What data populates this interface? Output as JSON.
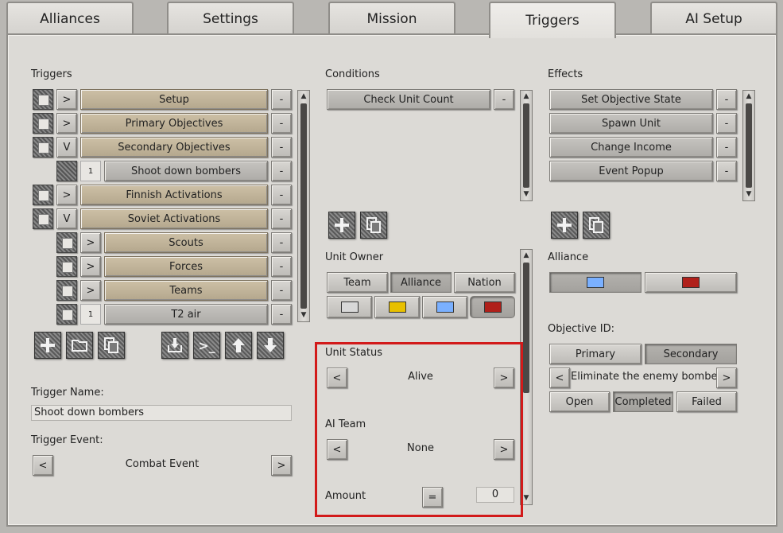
{
  "tabs": [
    "Alliances",
    "Settings",
    "Mission",
    "Triggers",
    "AI Setup"
  ],
  "triggers": {
    "heading": "Triggers",
    "items": [
      {
        "expander": ">",
        "label": "Setup"
      },
      {
        "expander": ">",
        "label": "Primary Objectives"
      },
      {
        "expander": "V",
        "label": "Secondary Objectives"
      },
      {
        "expander": "1",
        "label": "Shoot down bombers"
      },
      {
        "expander": ">",
        "label": "Finnish Activations"
      },
      {
        "expander": "V",
        "label": "Soviet Activations"
      },
      {
        "expander": ">",
        "label": "Scouts"
      },
      {
        "expander": ">",
        "label": "Forces"
      },
      {
        "expander": ">",
        "label": "Teams"
      },
      {
        "expander": "1",
        "label": "T2 air"
      }
    ],
    "remove_label": "-",
    "name_label": "Trigger Name:",
    "name_value": "Shoot down bombers",
    "event_label": "Trigger Event:",
    "event_value": "Combat Event",
    "prev": "<",
    "next": ">"
  },
  "conditions": {
    "heading": "Conditions",
    "items": [
      "Check Unit Count"
    ],
    "remove_label": "-"
  },
  "unit_owner": {
    "heading": "Unit Owner",
    "modes": [
      "Team",
      "Alliance",
      "Nation"
    ],
    "selected_mode": "Alliance",
    "colors": [
      "#d8d8d8",
      "#e8c000",
      "#7ab0ff",
      "#b0201a"
    ]
  },
  "unit_status": {
    "heading": "Unit Status",
    "value": "Alive",
    "prev": "<",
    "next": ">"
  },
  "ai_team": {
    "heading": "AI Team",
    "value": "None",
    "prev": "<",
    "next": ">"
  },
  "amount": {
    "heading": "Amount",
    "operator": "=",
    "value": "0"
  },
  "effects": {
    "heading": "Effects",
    "items": [
      "Set Objective State",
      "Spawn Unit",
      "Change Income",
      "Event Popup"
    ],
    "remove_label": "-"
  },
  "alliance": {
    "heading": "Alliance",
    "colors": [
      "#7ab0ff",
      "#b0201a"
    ]
  },
  "objective": {
    "heading": "Objective ID:",
    "types": [
      "Primary",
      "Secondary"
    ],
    "name": "Eliminate the enemy bombers",
    "prev": "<",
    "next": ">",
    "states": [
      "Open",
      "Completed",
      "Failed"
    ],
    "selected_state": "Completed"
  },
  "toolbar": {
    "terminal_symbol": ">_"
  }
}
